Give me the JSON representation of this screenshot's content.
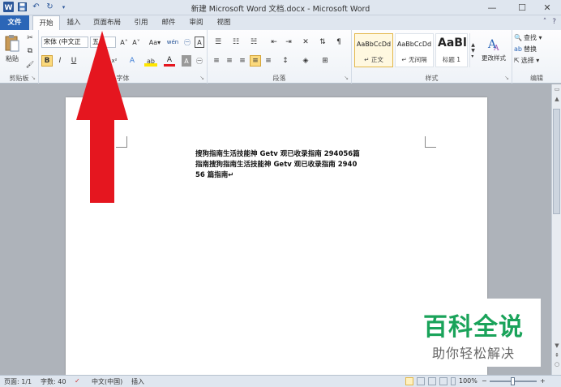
{
  "window": {
    "title": "新建 Microsoft Word 文档.docx - Microsoft Word",
    "minimize": "—",
    "maximize": "☐",
    "close": "✕"
  },
  "qat": {
    "save_icon": "save-icon",
    "undo": "↶",
    "redo": "↻"
  },
  "tabs": [
    {
      "label": "文件"
    },
    {
      "label": "开始"
    },
    {
      "label": "插入"
    },
    {
      "label": "页面布局"
    },
    {
      "label": "引用"
    },
    {
      "label": "邮件"
    },
    {
      "label": "审阅"
    },
    {
      "label": "视图"
    }
  ],
  "ribbon": {
    "clipboard": {
      "label": "剪贴板",
      "paste": "粘贴",
      "cut": "✂",
      "copy": "⧉",
      "format_painter": "🖌"
    },
    "font": {
      "label": "字体",
      "font_name": "宋体 (中文正",
      "font_size": "五号",
      "grow": "A˄",
      "shrink": "A˅",
      "change_case": "Aa▾",
      "pinyin": "wén",
      "char_border": "A",
      "bold": "B",
      "italic": "I",
      "underline": "U",
      "superscript": "x²",
      "text_effects": "A",
      "highlight": "ab",
      "font_color": "A",
      "char_shading": "A",
      "enclose": "㊀"
    },
    "paragraph": {
      "label": "段落",
      "bullets": "☰",
      "numbering": "☷",
      "multilevel": "☵",
      "decrease_indent": "⇤",
      "increase_indent": "⇥",
      "chinese_layout": "✕",
      "sort": "⇅",
      "show_marks": "¶",
      "align_left": "≡",
      "center": "≡",
      "align_right": "≡",
      "justify": "≡",
      "distributed": "≡",
      "line_spacing": "↕",
      "shading": "◈",
      "borders": "⊞"
    },
    "styles": {
      "label": "样式",
      "items": [
        {
          "sample": "AaBbCcDd",
          "name": "↵ 正文"
        },
        {
          "sample": "AaBbCcDd",
          "name": "↵ 无间隔"
        },
        {
          "sample": "AaBl",
          "name": "标题 1"
        }
      ],
      "change_styles": "更改样式"
    },
    "editing": {
      "label": "编辑",
      "find": "查找 ▾",
      "replace": "替换",
      "select": "选择 ▾"
    }
  },
  "document": {
    "text": "搜狗指南生活技能神 Getv 观已收录指南 294056篇指南搜狗指南生活技能神 Getv 观已收录指南 294056 篇指南↵"
  },
  "watermark": {
    "title": "百科全说",
    "subtitle": "助你轻松解决"
  },
  "statusbar": {
    "page": "页面: 1/1",
    "words": "字数: 40",
    "language": "中文(中国)",
    "insert_mode": "插入",
    "zoom": "100%",
    "zoom_minus": "−",
    "zoom_plus": "+",
    "zoom_level": 0.5
  },
  "colors": {
    "accent": "#2b66b7",
    "arrow": "#e5161f",
    "watermark_green": "#1aa35a"
  }
}
